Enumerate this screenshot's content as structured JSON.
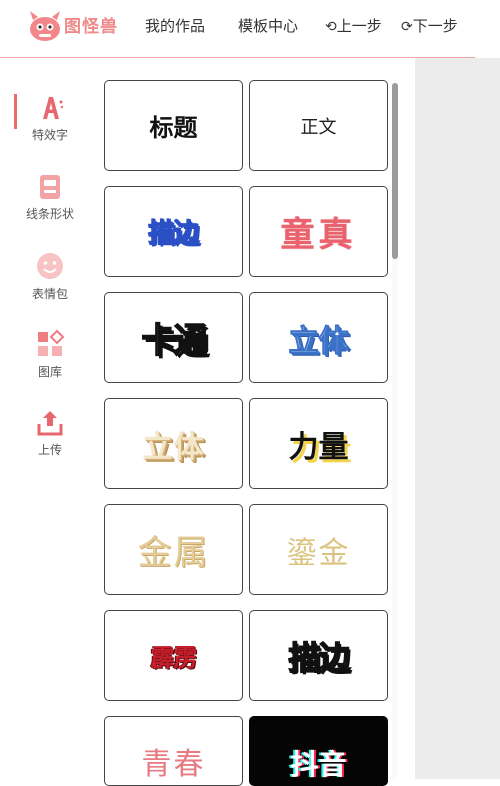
{
  "header": {
    "logo_text": "图怪兽",
    "nav_my_works": "我的作品",
    "nav_templates": "模板中心",
    "undo_label": "上一步",
    "redo_label": "下一步"
  },
  "sidebar": {
    "items": [
      {
        "label": "特效字",
        "icon": "text-effect-icon"
      },
      {
        "label": "线条形状",
        "icon": "shape-icon"
      },
      {
        "label": "表情包",
        "icon": "emoji-icon"
      },
      {
        "label": "图库",
        "icon": "gallery-icon"
      },
      {
        "label": "上传",
        "icon": "upload-icon"
      }
    ]
  },
  "cards": [
    {
      "text": "标题"
    },
    {
      "text": "正文"
    },
    {
      "text": "描边"
    },
    {
      "text": "童真"
    },
    {
      "text": "卡通"
    },
    {
      "text": "立体"
    },
    {
      "text": "立体"
    },
    {
      "text": "力量"
    },
    {
      "text": "金属"
    },
    {
      "text": "鎏金"
    },
    {
      "text": "霹雳"
    },
    {
      "text": "描边"
    },
    {
      "text": "青春"
    },
    {
      "text": "抖音"
    }
  ],
  "colors": {
    "accent": "#ea6d6d",
    "panel_gray": "#ececec"
  }
}
